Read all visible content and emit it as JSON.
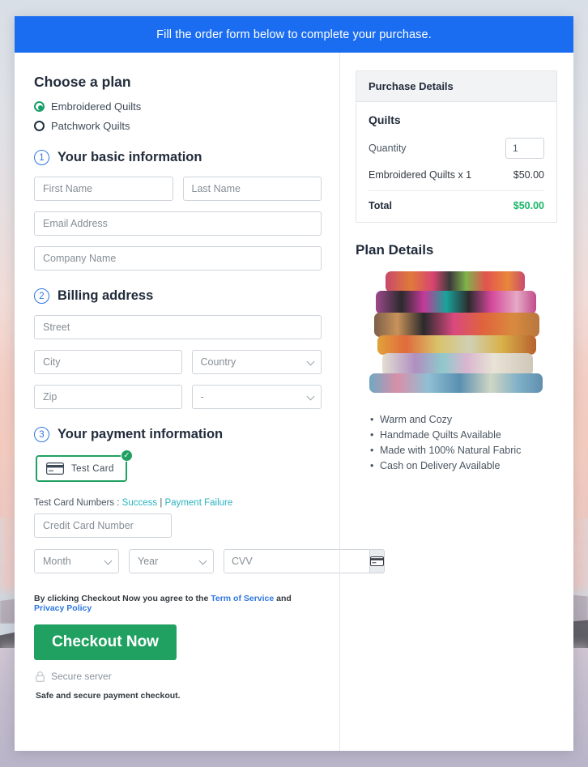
{
  "banner": {
    "text": "Fill the order form below to complete your purchase."
  },
  "plan": {
    "heading": "Choose a plan",
    "options": [
      {
        "label": "Embroidered Quilts",
        "selected": true
      },
      {
        "label": "Patchwork Quilts",
        "selected": false
      }
    ]
  },
  "steps": [
    {
      "num": "1",
      "title": "Your basic information"
    },
    {
      "num": "2",
      "title": "Billing address"
    },
    {
      "num": "3",
      "title": "Your payment information"
    }
  ],
  "basic": {
    "first_name_placeholder": "First Name",
    "last_name_placeholder": "Last Name",
    "email_placeholder": "Email Address",
    "company_placeholder": "Company Name"
  },
  "billing": {
    "street_placeholder": "Street",
    "city_placeholder": "City",
    "country_value": "Country",
    "zip_placeholder": "Zip",
    "state_value": "-"
  },
  "payment": {
    "test_card_label": "Test Card",
    "card_icon": "credit-card-icon",
    "check_icon": "check-circle-icon",
    "check_glyph": "✓",
    "test_numbers_prefix": "Test Card Numbers : ",
    "success_link": "Success",
    "separator": " | ",
    "failure_link": "Payment Failure",
    "card_number_placeholder": "Credit Card Number",
    "month_value": "Month",
    "year_value": "Year",
    "cvv_placeholder": "CVV",
    "cvv_icon": "credit-card-icon"
  },
  "footer": {
    "terms_prefix": "By clicking Checkout Now you agree to the ",
    "terms_link": "Term of Service",
    "terms_mid": " and ",
    "privacy_link": "Privacy Policy",
    "checkout_label": "Checkout Now",
    "lock_icon": "lock-icon",
    "secure_text": "Secure server",
    "safe_text": "Safe and secure payment checkout."
  },
  "purchase": {
    "panel_title": "Purchase Details",
    "product_group": "Quilts",
    "quantity_label": "Quantity",
    "quantity_value": "1",
    "line_item_label": "Embroidered Quilts x 1",
    "line_item_amount": "$50.00",
    "total_label": "Total",
    "total_amount": "$50.00",
    "total_color": "#18b566"
  },
  "plan_details": {
    "title": "Plan Details",
    "image_alt": "stack-of-quilts-photo",
    "features": [
      "Warm and Cozy",
      "Handmade Quilts Available",
      "Made with 100% Natural Fabric",
      "Cash on Delivery Available"
    ]
  },
  "colors": {
    "banner_blue": "#1a6df0",
    "accent_green": "#21a161",
    "link_blue": "#2f77e0",
    "link_teal": "#2bb3c0",
    "step_blue": "#2f77e0"
  }
}
